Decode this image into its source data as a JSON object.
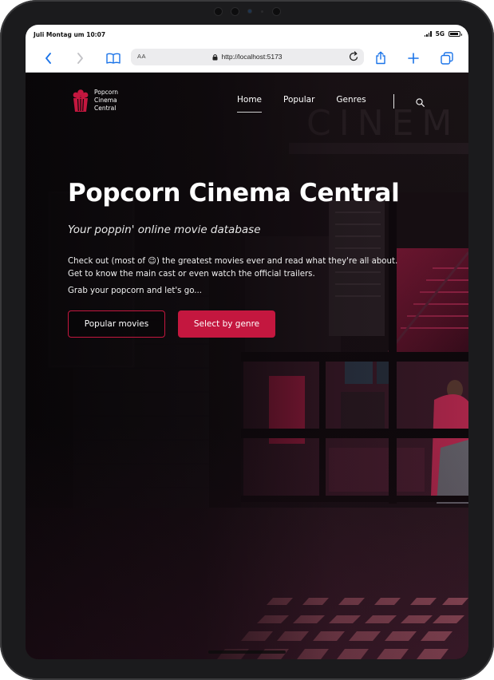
{
  "status": {
    "time": "Juli Montag um 10:07",
    "network": "5G"
  },
  "browser": {
    "reader_label": "AA",
    "url": "http://localhost:5173",
    "icons": [
      "back-icon",
      "forward-icon",
      "book-icon",
      "lock-icon",
      "reload-icon",
      "share-icon",
      "plus-icon",
      "tabs-icon"
    ]
  },
  "site": {
    "logo_text": "Popcorn Cinema Central",
    "nav": [
      {
        "label": "Home",
        "active": true
      },
      {
        "label": "Popular",
        "active": false
      },
      {
        "label": "Genres",
        "active": false
      }
    ],
    "search_icon": "search-icon"
  },
  "hero": {
    "title": "Popcorn Cinema Central",
    "subtitle": "Your poppin' online movie database",
    "line1": "Check out (most of 😉) the greatest movies ever and read what they're all about.",
    "line2": "Get to know the main cast or even watch the official trailers.",
    "line3": "Grab your popcorn and let's go...",
    "primary_button": "Popular movies",
    "secondary_button": "Select by genre"
  },
  "colors": {
    "accent": "#c4173f",
    "background": "#0b0709",
    "browser_blue": "#1a73e8"
  }
}
